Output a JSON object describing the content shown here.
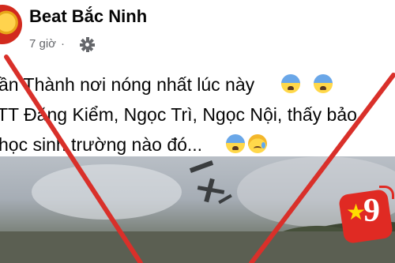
{
  "post": {
    "page_name": "Beat Bắc Ninh",
    "time": "7 giờ",
    "separator": "·",
    "privacy_icon": "gear-icon",
    "lines": [
      "ần Thành nơi nóng nhất lúc này",
      "TT Đăng Kiểm, Ngọc Trì, Ngọc Nội, thấy bảo",
      "học sinh trường nào đó..."
    ]
  },
  "overlay": {
    "stroke_color": "#d9302a",
    "meaning": "fake-news-x"
  },
  "watermark": {
    "logo_text": "9",
    "brand_color": "#e02a23"
  }
}
